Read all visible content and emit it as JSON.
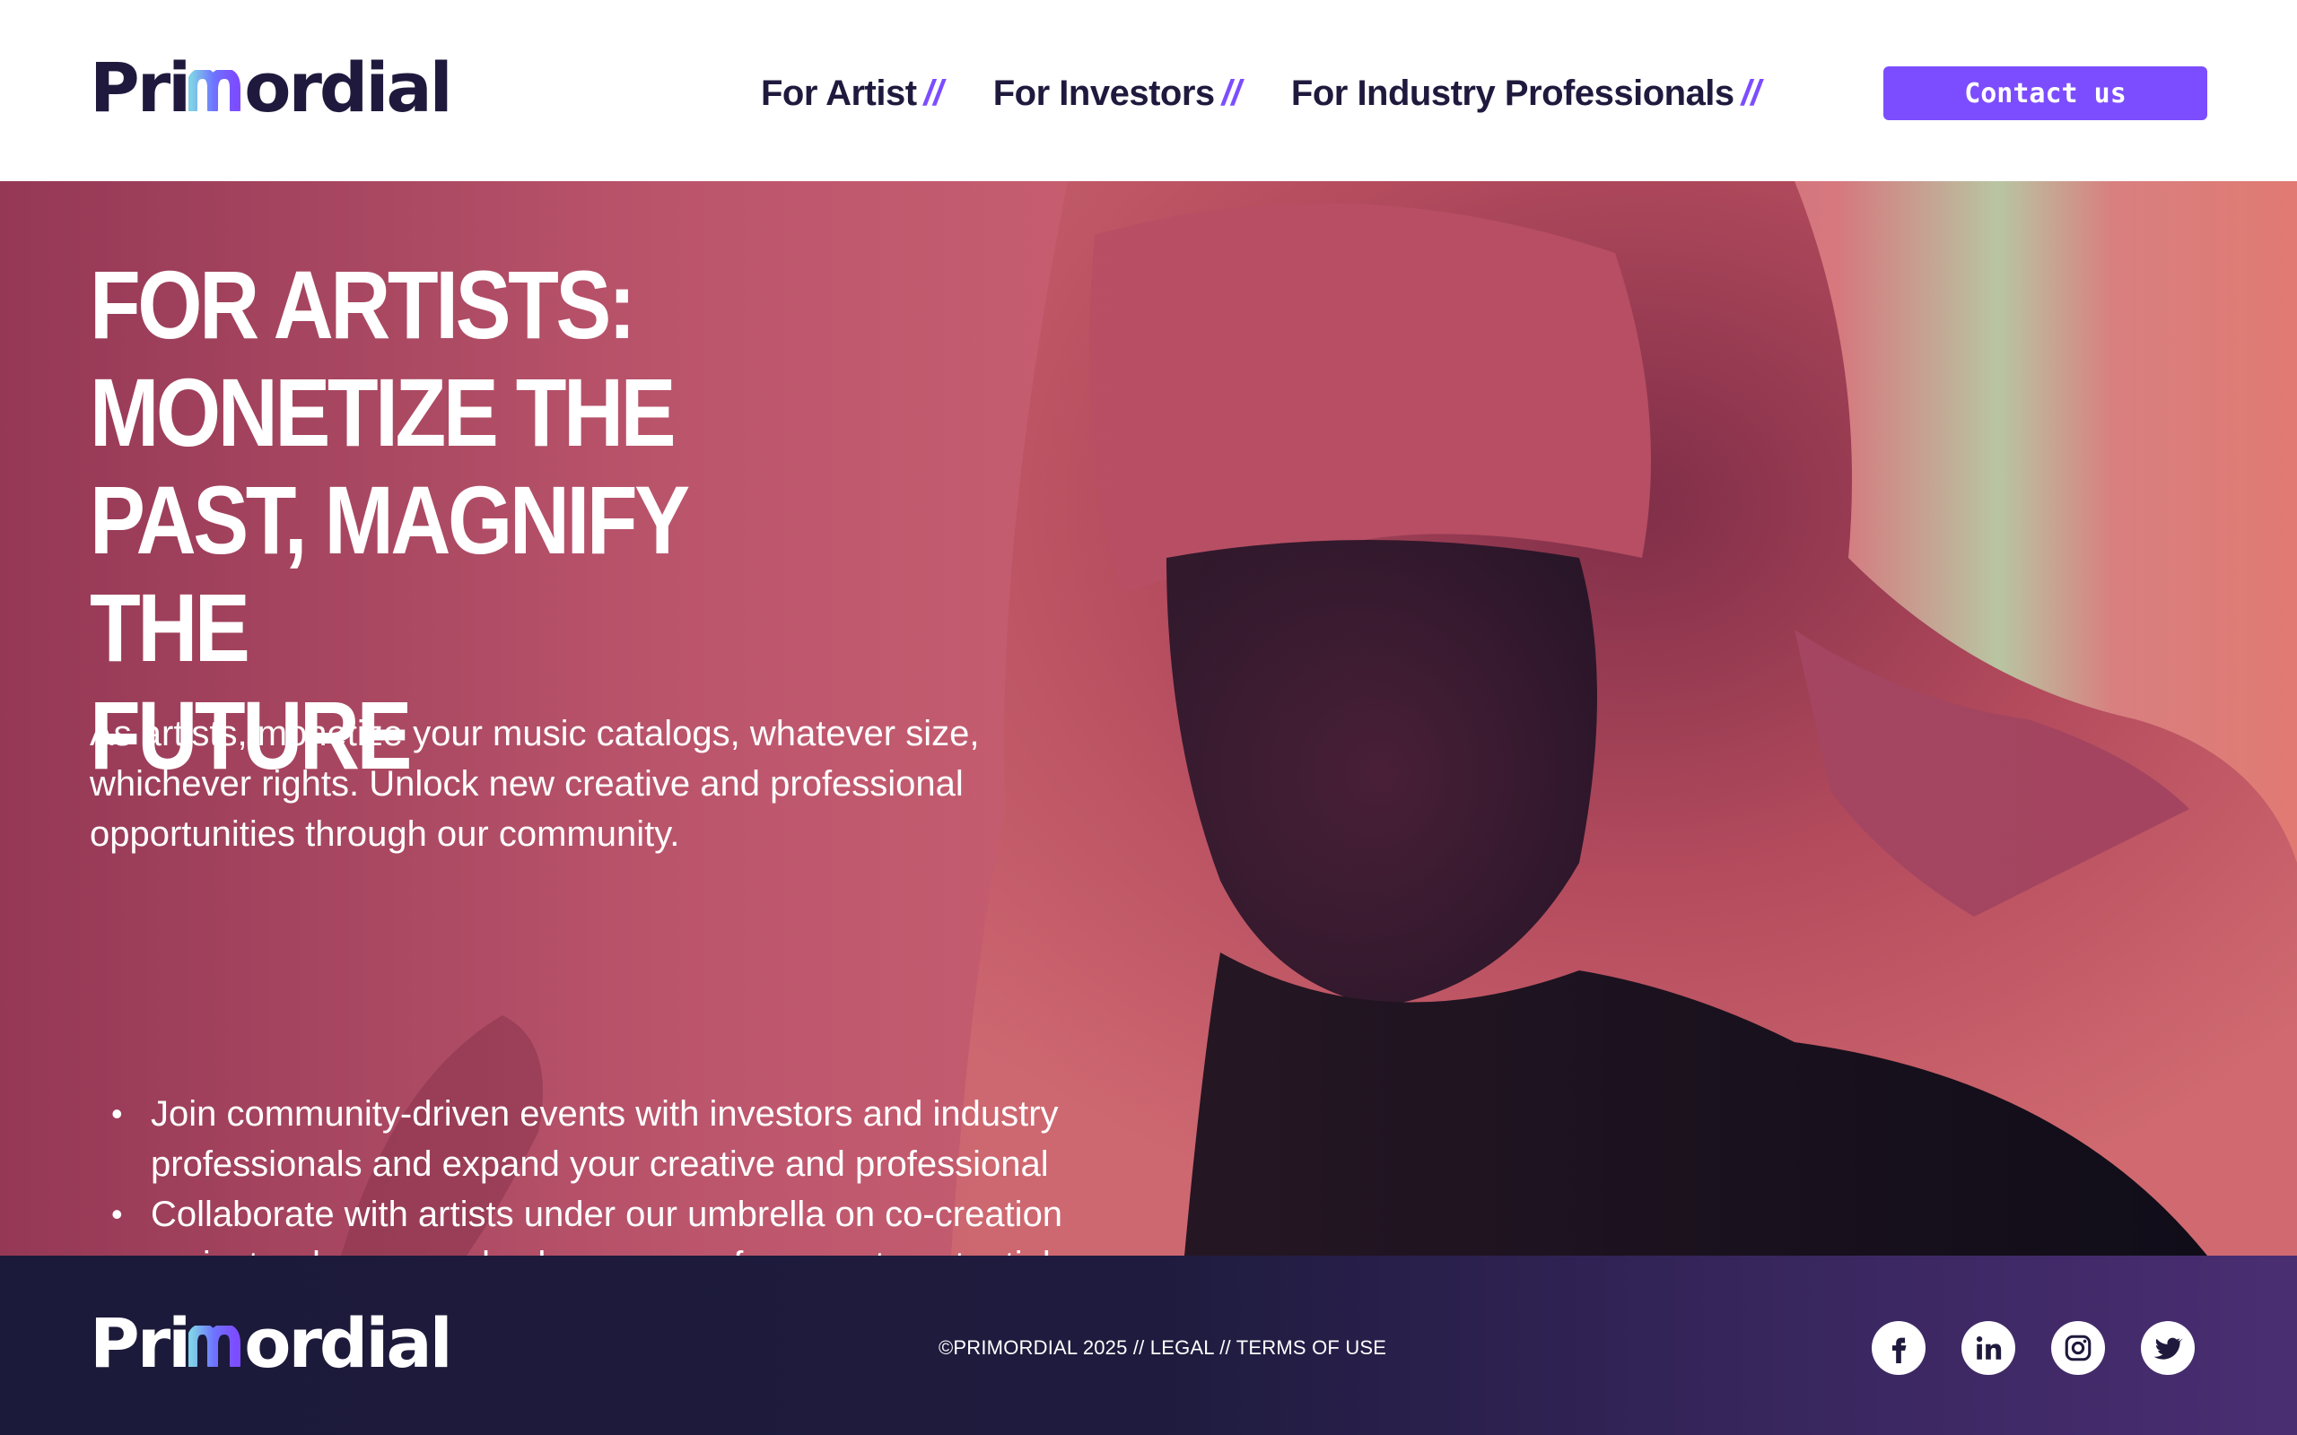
{
  "brand": {
    "name_left": "Pri",
    "name_right": "ordial",
    "accent": "#7c4dff",
    "dark": "#1f1a3d"
  },
  "nav": {
    "items": [
      {
        "label": "For Artist",
        "slash": "//"
      },
      {
        "label": "For Investors",
        "slash": "//"
      },
      {
        "label": "For Industry Professionals",
        "slash": "//"
      }
    ],
    "contact_label": "Contact us"
  },
  "hero": {
    "title_lines": [
      "FOR ARTISTS:",
      "MONETIZE THE",
      "PAST, MAGNIFY THE",
      "FUTURE"
    ],
    "description": "As artists, monetize your music catalogs, whatever size, whichever rights. Unlock new creative and professional opportunities through our community.",
    "bullets": [
      "Join community-driven events with investors and industry professionals and expand your creative and professional",
      "Collaborate with artists under our umbrella on co-creation projects where you also have ease of access to potential capital"
    ]
  },
  "footer": {
    "legal": "©PRIMORDIAL 2025 // LEGAL // TERMS OF USE",
    "socials": [
      {
        "icon": "facebook-icon"
      },
      {
        "icon": "linkedin-icon"
      },
      {
        "icon": "instagram-icon"
      },
      {
        "icon": "twitter-icon"
      }
    ]
  }
}
